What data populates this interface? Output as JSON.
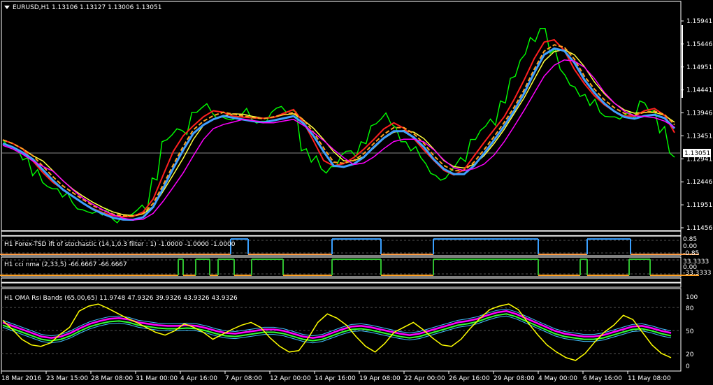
{
  "header": {
    "symbol_info": "EURUSD,H1  1.13106 1.13127 1.13006 1.13051",
    "menu_icon": "triangle-down-icon"
  },
  "price_axis": {
    "ticks": [
      "1.15941",
      "1.15446",
      "1.14951",
      "1.14441",
      "1.13946",
      "1.13451",
      "1.12941",
      "1.12446",
      "1.11951",
      "1.11456"
    ],
    "current_price": "1.13051"
  },
  "indicators": {
    "tsd": {
      "title": "H1 Forex-TSD ift of stochastic (14,1,0.3 filter : 1) -1.0000 -1.0000 -1.0000",
      "levels": [
        "0.85",
        "0.00",
        "-0.85"
      ]
    },
    "cci": {
      "title": "H1 cci nma (2,33,5) -66.6667 -66.6667",
      "levels": [
        "33.3333",
        "0.00",
        "-33.3333"
      ]
    },
    "oma": {
      "title": "H1 OMA Rsi Bands (65.00,65) 11.9748 47.9326 39.9326 43.9326 43.9326",
      "levels": [
        "100",
        "80",
        "50",
        "20",
        "0"
      ]
    }
  },
  "time_axis": [
    "18 Mar 2016",
    "23 Mar 15:00",
    "28 Mar 08:00",
    "31 Mar 00:00",
    "4 Apr 16:00",
    "7 Apr 08:00",
    "12 Apr 00:00",
    "14 Apr 16:00",
    "19 Apr 08:00",
    "22 Apr 00:00",
    "26 Apr 16:00",
    "29 Apr 08:00",
    "4 May 00:00",
    "6 May 16:00",
    "11 May 08:00"
  ],
  "colors": {
    "price": "#00ff00",
    "ma_red": "#ff2020",
    "ma_orange": "#ffa020",
    "ma_yellow": "#ffff40",
    "ma_blue": "#40a0ff",
    "ma_magenta": "#ff00ff",
    "ma_white": "#ffffff",
    "tsd_line": "#3aa0ff",
    "tsd_alt": "#ff9a40",
    "cci_green": "#30c030",
    "cci_orange": "#ffa020",
    "rsi_yellow": "#ffff00",
    "band_magenta": "#ff00ff",
    "band_green": "#30ff30",
    "band_cyan": "#40c0ff"
  },
  "chart_data": {
    "type": "line",
    "price_series": [
      1.1334,
      1.1318,
      1.129,
      1.1255,
      1.124,
      1.1226,
      1.1208,
      1.1195,
      1.118,
      1.1172,
      1.1168,
      1.116,
      1.1165,
      1.117,
      1.119,
      1.125,
      1.133,
      1.1345,
      1.1355,
      1.1395,
      1.1405,
      1.1395,
      1.1385,
      1.1378,
      1.139,
      1.138,
      1.1375,
      1.1395,
      1.1408,
      1.14,
      1.131,
      1.1285,
      1.127,
      1.1275,
      1.13,
      1.131,
      1.133,
      1.1365,
      1.138,
      1.137,
      1.133,
      1.131,
      1.1295,
      1.126,
      1.1245,
      1.1265,
      1.1295,
      1.1335,
      1.1355,
      1.138,
      1.142,
      1.147,
      1.151,
      1.156,
      1.158,
      1.1525,
      1.149,
      1.1455,
      1.143,
      1.141,
      1.1395,
      1.1385,
      1.138,
      1.1395,
      1.142,
      1.1395,
      1.135,
      1.1305
    ],
    "price_range": [
      1.114,
      1.1612
    ],
    "tsd_segments": [
      [
        0,
        0.0
      ],
      [
        330,
        0.0
      ],
      [
        330,
        1
      ],
      [
        355,
        1
      ],
      [
        355,
        0
      ],
      [
        475,
        0
      ],
      [
        475,
        1
      ],
      [
        545,
        1
      ],
      [
        545,
        0
      ],
      [
        620,
        0
      ],
      [
        620,
        1
      ],
      [
        770,
        1
      ],
      [
        770,
        0
      ],
      [
        840,
        0
      ],
      [
        840,
        1
      ],
      [
        902,
        1
      ],
      [
        902,
        0
      ],
      [
        1000,
        0
      ]
    ],
    "cci_segments": [
      [
        0,
        0
      ],
      [
        255,
        0
      ],
      [
        255,
        1
      ],
      [
        262,
        1
      ],
      [
        262,
        0
      ],
      [
        280,
        0
      ],
      [
        280,
        1
      ],
      [
        300,
        1
      ],
      [
        300,
        0
      ],
      [
        312,
        0
      ],
      [
        312,
        1
      ],
      [
        335,
        1
      ],
      [
        335,
        0
      ],
      [
        360,
        0
      ],
      [
        360,
        1
      ],
      [
        405,
        1
      ],
      [
        405,
        0
      ],
      [
        475,
        0
      ],
      [
        475,
        1
      ],
      [
        545,
        1
      ],
      [
        545,
        0
      ],
      [
        620,
        0
      ],
      [
        620,
        1
      ],
      [
        770,
        1
      ],
      [
        770,
        0
      ],
      [
        830,
        0
      ],
      [
        830,
        1
      ],
      [
        840,
        1
      ],
      [
        840,
        0
      ],
      [
        900,
        0
      ],
      [
        900,
        1
      ],
      [
        930,
        1
      ],
      [
        930,
        0
      ],
      [
        1000,
        0
      ]
    ],
    "rsi_values": [
      65,
      52,
      38,
      30,
      28,
      33,
      45,
      55,
      78,
      85,
      88,
      82,
      75,
      68,
      62,
      55,
      48,
      44,
      50,
      60,
      55,
      48,
      38,
      45,
      52,
      58,
      62,
      55,
      40,
      28,
      20,
      22,
      40,
      62,
      74,
      68,
      58,
      42,
      28,
      20,
      32,
      48,
      55,
      62,
      52,
      40,
      30,
      28,
      38,
      54,
      68,
      80,
      85,
      88,
      80,
      62,
      45,
      30,
      20,
      12,
      8,
      18,
      34,
      48,
      58,
      72,
      66,
      48,
      30,
      18,
      12
    ],
    "band_values": [
      60,
      55,
      50,
      45,
      40,
      38,
      40,
      45,
      52,
      58,
      62,
      65,
      66,
      64,
      60,
      58,
      56,
      55,
      55,
      56,
      55,
      52,
      48,
      45,
      44,
      46,
      48,
      50,
      50,
      48,
      44,
      40,
      38,
      40,
      45,
      50,
      54,
      55,
      53,
      50,
      47,
      44,
      42,
      44,
      48,
      52,
      56,
      60,
      62,
      65,
      70,
      74,
      76,
      72,
      66,
      60,
      54,
      48,
      44,
      42,
      40,
      40,
      42,
      46,
      50,
      54,
      55,
      52,
      48,
      45
    ]
  }
}
